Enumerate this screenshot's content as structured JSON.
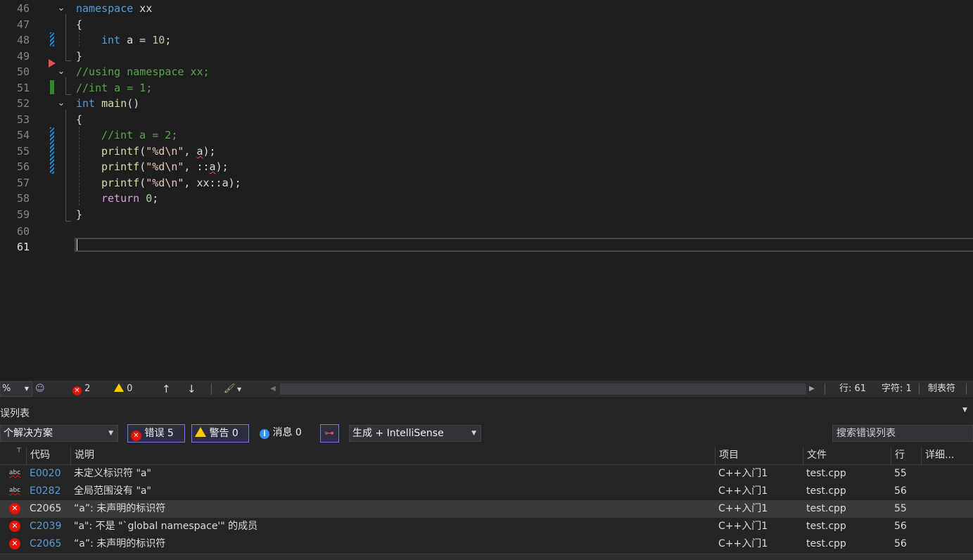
{
  "editor": {
    "lines": [
      {
        "n": "46"
      },
      {
        "n": "47"
      },
      {
        "n": "48"
      },
      {
        "n": "49"
      },
      {
        "n": "50"
      },
      {
        "n": "51"
      },
      {
        "n": "52"
      },
      {
        "n": "53"
      },
      {
        "n": "54"
      },
      {
        "n": "55"
      },
      {
        "n": "56"
      },
      {
        "n": "57"
      },
      {
        "n": "58"
      },
      {
        "n": "59"
      },
      {
        "n": "60"
      },
      {
        "n": "61"
      }
    ],
    "code": {
      "l46_kw": "namespace",
      "l46_id": " xx",
      "l47": "{",
      "l48_kw": "int",
      "l48_id": " a = ",
      "l48_num": "10",
      "l48_end": ";",
      "l49": "}",
      "l50": "//using namespace xx;",
      "l51": "//int a = 1;",
      "l52_kw": "int",
      "l52_fn": " main",
      "l52_end": "()",
      "l53": "{",
      "l54": "//int a = 2;",
      "l55_fn": "printf",
      "l55_p": "(",
      "l55_str": "\"%d",
      "l55_esc": "\\n",
      "l55_str2": "\"",
      "l55_mid": ", ",
      "l55_var": "a",
      "l55_end": ");",
      "l56_fn": "printf",
      "l56_p": "(",
      "l56_str": "\"%d",
      "l56_esc": "\\n",
      "l56_str2": "\"",
      "l56_mid": ", ::",
      "l56_var": "a",
      "l56_end": ");",
      "l57_fn": "printf",
      "l57_p": "(",
      "l57_str": "\"%d",
      "l57_esc": "\\n",
      "l57_str2": "\"",
      "l57_mid": ", xx::a);",
      "l58_kw": "return",
      "l58_num": " 0",
      "l58_end": ";",
      "l59": "}"
    }
  },
  "status": {
    "zoom": "%",
    "errors": "2",
    "warnings": "0",
    "line": "行: 61",
    "col": "字符: 1",
    "tabs": "制表符"
  },
  "panel": {
    "title": "误列表",
    "scope": "个解决方案",
    "errors_btn": "错误 5",
    "warnings_btn": "警告 0",
    "messages_btn": "消息 0",
    "build_filter": "生成 + IntelliSense",
    "search_placeholder": "搜索错误列表",
    "columns": {
      "code": "代码",
      "desc": "说明",
      "project": "项目",
      "file": "文件",
      "line": "行",
      "detail": "详细..."
    },
    "rows": [
      {
        "icon": "intellisense",
        "code": "E0020",
        "desc": "未定义标识符 \"a\"",
        "project": "C++入门1",
        "file": "test.cpp",
        "line": "55"
      },
      {
        "icon": "intellisense",
        "code": "E0282",
        "desc": "全局范围没有 \"a\"",
        "project": "C++入门1",
        "file": "test.cpp",
        "line": "56"
      },
      {
        "icon": "error",
        "code": "C2065",
        "desc": "“a”: 未声明的标识符",
        "project": "C++入门1",
        "file": "test.cpp",
        "line": "55"
      },
      {
        "icon": "error",
        "code": "C2039",
        "desc": "\"a\": 不是 \"`global namespace'\" 的成员",
        "project": "C++入门1",
        "file": "test.cpp",
        "line": "56"
      },
      {
        "icon": "error",
        "code": "C2065",
        "desc": "“a”: 未声明的标识符",
        "project": "C++入门1",
        "file": "test.cpp",
        "line": "56"
      }
    ]
  },
  "colors": {
    "keyword": "#569cd6",
    "control_keyword": "#d8a0df",
    "function": "#dcdcaa",
    "comment": "#57a64a",
    "error": "#e51400"
  }
}
